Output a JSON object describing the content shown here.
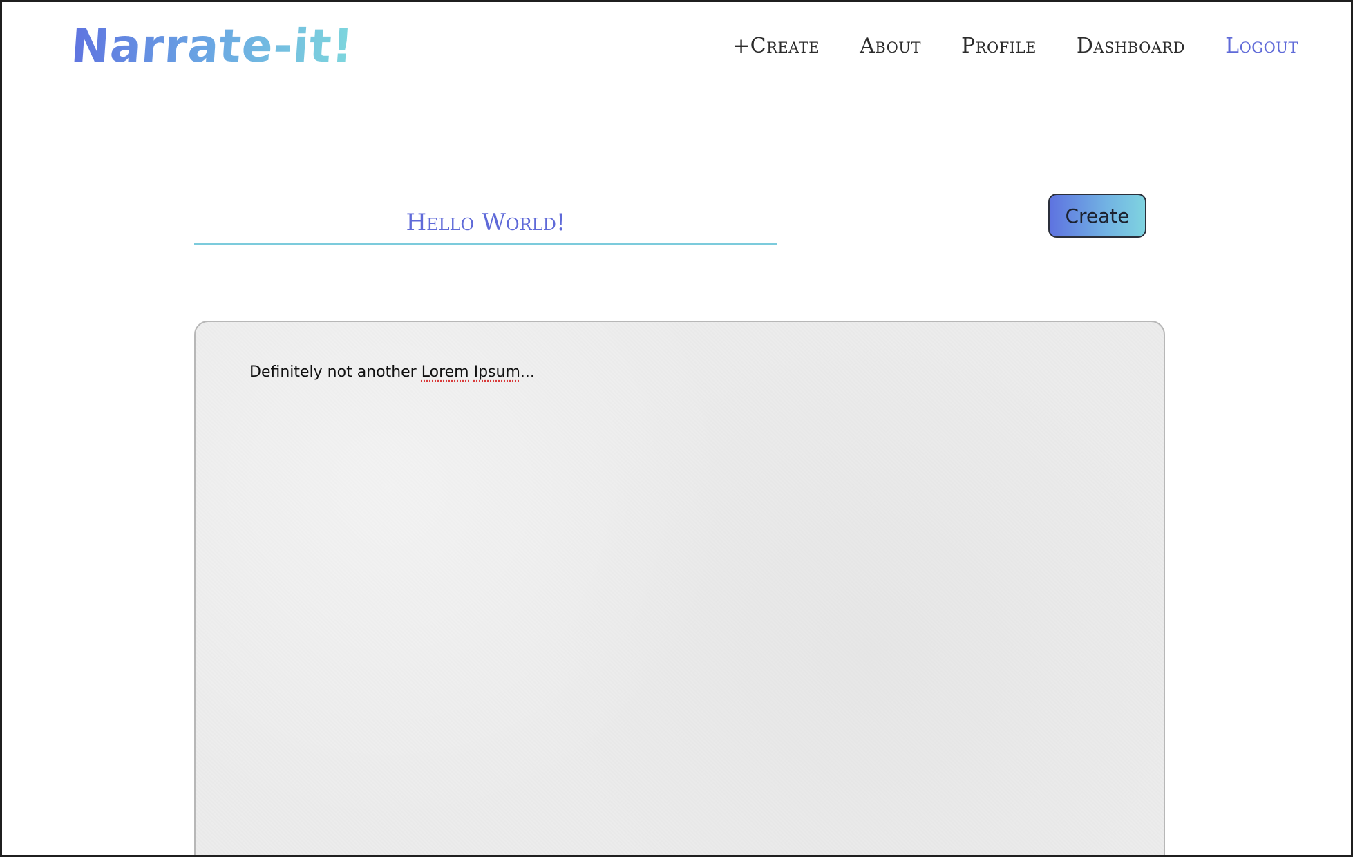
{
  "header": {
    "logo_text": "Narrate-it!",
    "nav": [
      {
        "label": "+Create",
        "active": false
      },
      {
        "label": "About",
        "active": false
      },
      {
        "label": "Profile",
        "active": false
      },
      {
        "label": "Dashboard",
        "active": false
      },
      {
        "label": "Logout",
        "active": true
      }
    ]
  },
  "editor": {
    "title_value": "Hello World!",
    "create_label": "Create",
    "body_prefix": "Definitely not another ",
    "body_word1": "Lorem",
    "body_space": " ",
    "body_word2": "Ipsum",
    "body_suffix": "..."
  },
  "colors": {
    "accent": "#5f6ad8",
    "underline": "#7ccbdc",
    "editor_bg": "#ececec"
  }
}
